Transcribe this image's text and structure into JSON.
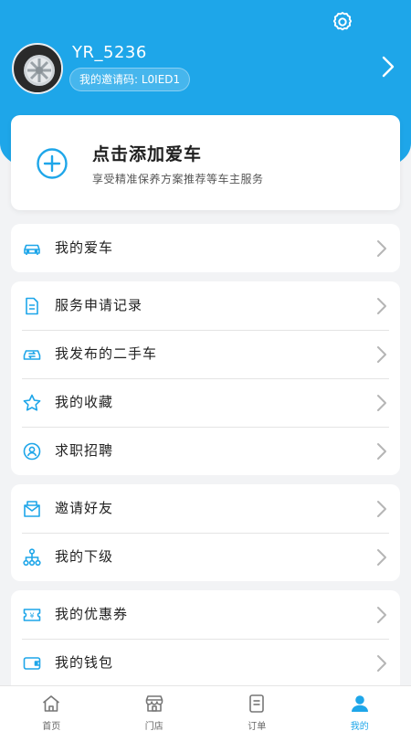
{
  "header": {
    "username": "YR_5236",
    "invite_code": "我的邀请码: L0IED1",
    "accent": "#1ea6e9"
  },
  "add_car": {
    "title": "点击添加爱车",
    "subtitle": "享受精准保养方案推荐等车主服务"
  },
  "groups": [
    [
      {
        "icon": "car-icon",
        "label": "我的爱车"
      }
    ],
    [
      {
        "icon": "document-icon",
        "label": "服务申请记录"
      },
      {
        "icon": "used-car-icon",
        "label": "我发布的二手车"
      },
      {
        "icon": "star-icon",
        "label": "我的收藏"
      },
      {
        "icon": "user-badge-icon",
        "label": "求职招聘"
      }
    ],
    [
      {
        "icon": "mail-icon",
        "label": "邀请好友"
      },
      {
        "icon": "org-tree-icon",
        "label": "我的下级"
      }
    ],
    [
      {
        "icon": "coupon-icon",
        "label": "我的优惠券"
      },
      {
        "icon": "wallet-icon",
        "label": "我的钱包"
      }
    ]
  ],
  "tabbar": {
    "items": [
      {
        "icon": "home-icon",
        "label": "首页"
      },
      {
        "icon": "store-icon",
        "label": "门店"
      },
      {
        "icon": "orders-icon",
        "label": "订单"
      },
      {
        "icon": "profile-icon",
        "label": "我的"
      }
    ],
    "active": "我的"
  }
}
